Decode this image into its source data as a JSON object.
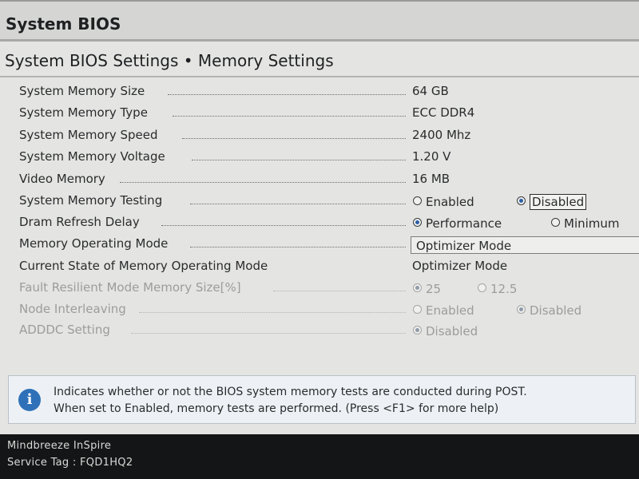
{
  "window": {
    "title": "System BIOS"
  },
  "page": {
    "breadcrumb": "System BIOS Settings • Memory Settings"
  },
  "settings": [
    {
      "label": "System Memory Size",
      "value": "64 GB"
    },
    {
      "label": "System Memory Type",
      "value": "ECC DDR4"
    },
    {
      "label": "System Memory Speed",
      "value": "2400 Mhz"
    },
    {
      "label": "System Memory Voltage",
      "value": "1.20 V"
    },
    {
      "label": "Video Memory",
      "value": "16 MB"
    },
    {
      "label": "System Memory Testing",
      "options": [
        "Enabled",
        "Disabled"
      ],
      "selected": "Disabled"
    },
    {
      "label": "Dram Refresh Delay",
      "options": [
        "Performance",
        "Minimum"
      ],
      "selected": "Performance"
    },
    {
      "label": "Memory Operating Mode",
      "value": "Optimizer Mode"
    },
    {
      "label": "Current State of Memory Operating Mode",
      "value": "Optimizer Mode"
    },
    {
      "label": "Fault Resilient Mode Memory Size[%]",
      "options": [
        "25",
        "12.5"
      ],
      "selected": "25"
    },
    {
      "label": "Node Interleaving",
      "options": [
        "Enabled",
        "Disabled"
      ],
      "selected": "Disabled"
    },
    {
      "label": "ADDDC Setting",
      "options": [
        "Disabled"
      ],
      "selected": "Disabled"
    }
  ],
  "help": {
    "icon": "info-icon",
    "line1": "Indicates whether or not the BIOS system memory tests are conducted during POST.",
    "line2": "When set to Enabled, memory tests are performed. (Press <F1> for more help)"
  },
  "footer": {
    "system_name": "Mindbreeze InSpire",
    "service_tag": "Service Tag : FQD1HQ2"
  },
  "colors": {
    "background": "#e4e5e3",
    "radio_selected": "#2c5fa6",
    "info_icon": "#2f71b8",
    "footer_bg": "#141516"
  }
}
